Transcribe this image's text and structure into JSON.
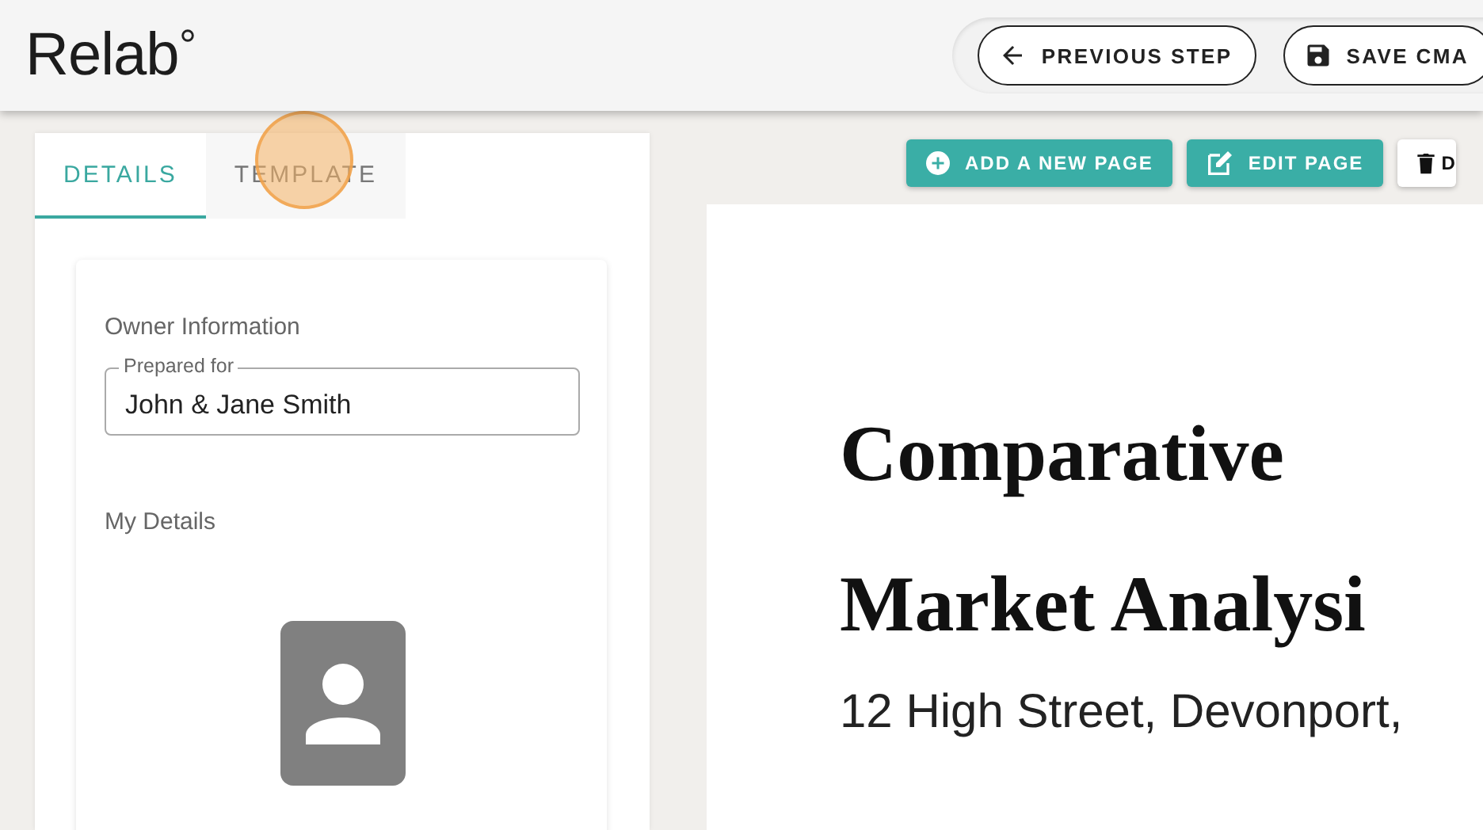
{
  "header": {
    "logo": "Relab",
    "actions": [
      {
        "label": "PREVIOUS STEP"
      },
      {
        "label": "SAVE CMA"
      }
    ]
  },
  "tabs": [
    {
      "label": "DETAILS",
      "selected": true
    },
    {
      "label": "TEMPLATE",
      "selected": false
    }
  ],
  "details": {
    "owner_heading": "Owner Information",
    "prepared_for": {
      "label": "Prepared for",
      "value": "John & Jane Smith"
    },
    "my_details_heading": "My Details"
  },
  "toolbar": [
    {
      "label": "ADD A NEW PAGE",
      "kind": "primary"
    },
    {
      "label": "EDIT PAGE",
      "kind": "primary"
    },
    {
      "label": "D",
      "kind": "secondary"
    }
  ],
  "document": {
    "title_lines": [
      "Comparative",
      "Market Analysi"
    ],
    "address": "12 High Street, Devonport,"
  }
}
